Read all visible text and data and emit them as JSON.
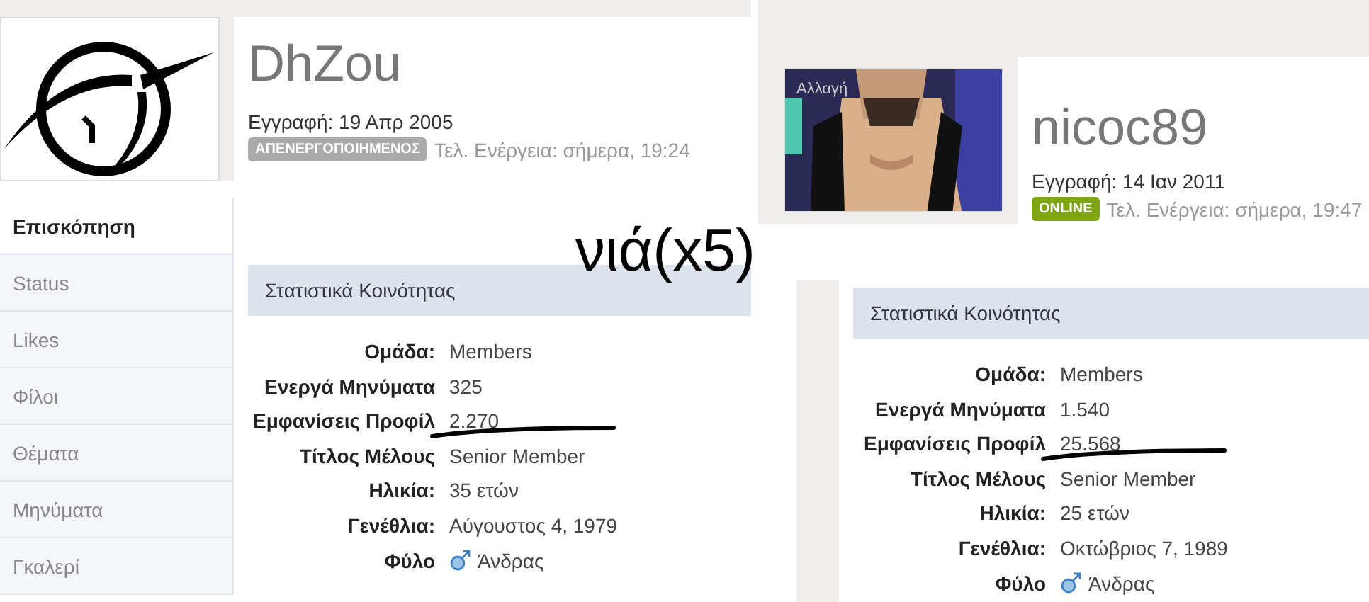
{
  "profiles": [
    {
      "avatar": {
        "kind": "logo"
      },
      "username": "DhZou",
      "joined": "Εγγραφή: 19 Απρ 2005",
      "status": {
        "label": "ΑΠΕΝΕΡΓΟΠΟΙΗΜΕΝΟΣ",
        "kind": "offline"
      },
      "last_activity": "Τελ. Ενέργεια: σήμερα, 19:24",
      "nav": [
        {
          "label": "Επισκόπηση",
          "selected": true
        },
        {
          "label": "Status",
          "selected": false
        },
        {
          "label": "Likes",
          "selected": false
        },
        {
          "label": "Φίλοι",
          "selected": false
        },
        {
          "label": "Θέματα",
          "selected": false
        },
        {
          "label": "Μηνύματα",
          "selected": false
        },
        {
          "label": "Γκαλερί",
          "selected": false
        }
      ],
      "stats": {
        "title": "Στατιστικά Κοινότητας",
        "rows": [
          {
            "label": "Ομάδα:",
            "value": "Members",
            "underlined": false
          },
          {
            "label": "Ενεργά Μηνύματα",
            "value": "325",
            "underlined": false
          },
          {
            "label": "Εμφανίσεις Προφίλ",
            "value": "2.270",
            "underlined": true
          },
          {
            "label": "Τίτλος Μέλους",
            "value": "Senior Member",
            "underlined": false
          },
          {
            "label": "Ηλικία:",
            "value": "35 ετών",
            "underlined": false
          },
          {
            "label": "Γενέθλια:",
            "value": "Αύγουστος 4, 1979",
            "underlined": false
          },
          {
            "label": "Φύλο",
            "value": "Άνδρας",
            "underlined": false,
            "kind": "gender"
          }
        ]
      }
    },
    {
      "avatar": {
        "kind": "picture",
        "overlay": "Αλλαγή"
      },
      "username": "nicoc89",
      "joined": "Εγγραφή: 14 Ιαν 2011",
      "status": {
        "label": "ONLINE",
        "kind": "online"
      },
      "last_activity": "Τελ. Ενέργεια: σήμερα, 19:47",
      "stats": {
        "title": "Στατιστικά Κοινότητας",
        "rows": [
          {
            "label": "Ομάδα:",
            "value": "Members",
            "underlined": false
          },
          {
            "label": "Ενεργά Μηνύματα",
            "value": "1.540",
            "underlined": false
          },
          {
            "label": "Εμφανίσεις Προφίλ",
            "value": "25.568",
            "underlined": true
          },
          {
            "label": "Τίτλος Μέλους",
            "value": "Senior Member",
            "underlined": false
          },
          {
            "label": "Ηλικία:",
            "value": "25 ετών",
            "underlined": false
          },
          {
            "label": "Γενέθλια:",
            "value": "Οκτώβριος 7, 1989",
            "underlined": false
          },
          {
            "label": "Φύλο",
            "value": "Άνδρας",
            "underlined": false,
            "kind": "gender"
          }
        ]
      }
    }
  ],
  "annotation": "νιά(x5)"
}
